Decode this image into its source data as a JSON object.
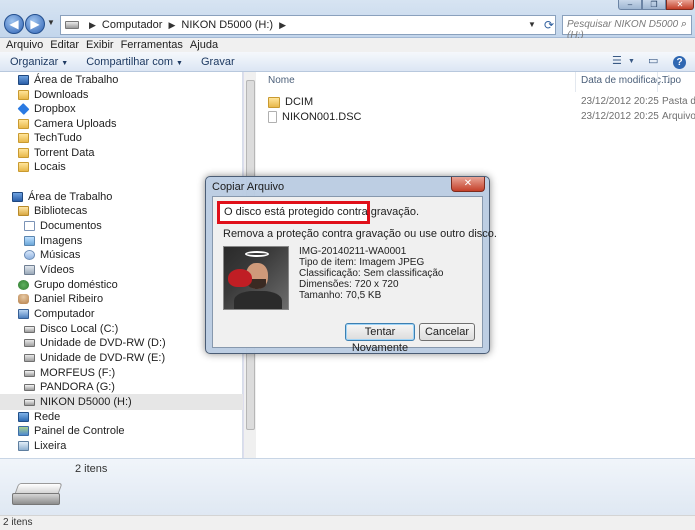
{
  "address": {
    "crumbs": [
      "Computador",
      "NIKON D5000 (H:)"
    ],
    "search_placeholder": "Pesquisar NIKON D5000 (H:)"
  },
  "menu": [
    "Arquivo",
    "Editar",
    "Exibir",
    "Ferramentas",
    "Ajuda"
  ],
  "toolbar": {
    "organize": "Organizar",
    "share": "Compartilhar com",
    "burn": "Gravar"
  },
  "nav": {
    "favorites": [
      {
        "label": "Área de Trabalho",
        "icon": "desktop-icon"
      },
      {
        "label": "Downloads",
        "icon": "folder-icon"
      },
      {
        "label": "Dropbox",
        "icon": "dropbox-icon"
      },
      {
        "label": "Camera Uploads",
        "icon": "folder-icon"
      },
      {
        "label": "TechTudo",
        "icon": "folder-icon"
      },
      {
        "label": "Torrent Data",
        "icon": "folder-icon"
      },
      {
        "label": "Locais",
        "icon": "folder-icon"
      }
    ],
    "tree": [
      {
        "label": "Área de Trabalho",
        "icon": "desktop-icon"
      },
      {
        "label": "Bibliotecas",
        "icon": "library-icon"
      },
      {
        "label": "Documentos",
        "icon": "documents-icon"
      },
      {
        "label": "Imagens",
        "icon": "pictures-icon"
      },
      {
        "label": "Músicas",
        "icon": "music-icon"
      },
      {
        "label": "Vídeos",
        "icon": "videos-icon"
      },
      {
        "label": "Grupo doméstico",
        "icon": "homegroup-icon"
      },
      {
        "label": "Daniel Ribeiro",
        "icon": "user-icon"
      },
      {
        "label": "Computador",
        "icon": "computer-icon"
      },
      {
        "label": "Disco Local (C:)",
        "icon": "drive-icon"
      },
      {
        "label": "Unidade de DVD-RW (D:)",
        "icon": "dvd-icon"
      },
      {
        "label": "Unidade de DVD-RW (E:)",
        "icon": "dvd-icon"
      },
      {
        "label": "MORFEUS (F:)",
        "icon": "drive-icon"
      },
      {
        "label": "PANDORA (G:)",
        "icon": "drive-icon"
      },
      {
        "label": "NIKON D5000 (H:)",
        "icon": "drive-icon"
      },
      {
        "label": "Rede",
        "icon": "network-icon"
      },
      {
        "label": "Painel de Controle",
        "icon": "control-panel-icon"
      },
      {
        "label": "Lixeira",
        "icon": "recycle-bin-icon"
      }
    ]
  },
  "columns": {
    "name": "Nome",
    "date": "Data de modificaç...",
    "type": "Tipo"
  },
  "files": [
    {
      "name": "DCIM",
      "date": "23/12/2012 20:25",
      "type": "Pasta de",
      "icon": "folder-icon"
    },
    {
      "name": "NIKON001.DSC",
      "date": "23/12/2012 20:25",
      "type": "Arquivo D",
      "icon": "file-icon"
    }
  ],
  "details": {
    "count": "2 itens"
  },
  "status": {
    "text": "2 itens"
  },
  "dialog": {
    "title": "Copiar Arquivo",
    "error": "O disco está protegido contra gravação.",
    "instruction": "Remova a proteção contra gravação ou use outro disco.",
    "file": {
      "name": "IMG-20140211-WA0001",
      "type": "Tipo de item: Imagem JPEG",
      "rating": "Classificação: Sem classificação",
      "dimensions": "Dimensões: 720 x 720",
      "size": "Tamanho: 70,5 KB"
    },
    "retry": "Tentar Novamente",
    "cancel": "Cancelar"
  }
}
